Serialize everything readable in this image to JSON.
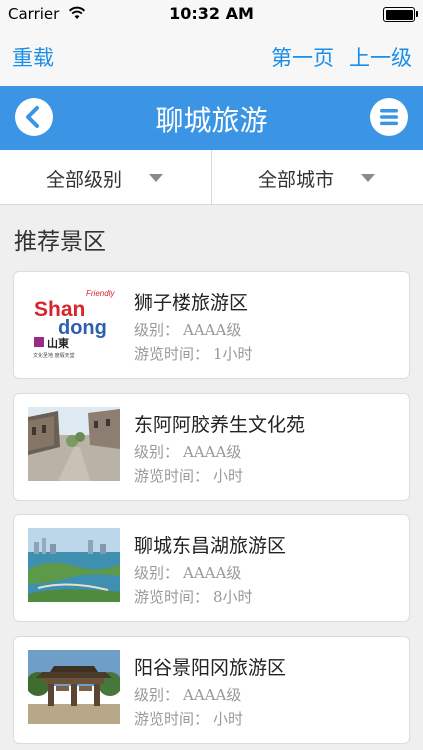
{
  "status_bar": {
    "carrier": "Carrier",
    "time": "10:32 AM",
    "wifi_icon": "wifi-icon",
    "battery_icon": "battery-icon"
  },
  "browser_nav": {
    "reload": "重载",
    "first_page": "第一页",
    "up_level": "上一级"
  },
  "header": {
    "title": "聊城旅游",
    "back_icon": "chevron-left-icon",
    "menu_icon": "menu-icon",
    "accent_color": "#3b95e4"
  },
  "filters": {
    "level": "全部级别",
    "city": "全部城市"
  },
  "section": {
    "title": "推荐景区"
  },
  "labels": {
    "level_label": "级别：",
    "time_label": "游览时间："
  },
  "spots": [
    {
      "name": "狮子楼旅游区",
      "level": "AAAA级",
      "duration": "1小时"
    },
    {
      "name": "东阿阿胶养生文化苑",
      "level": "AAAA级",
      "duration": "小时"
    },
    {
      "name": "聊城东昌湖旅游区",
      "level": "AAAA级",
      "duration": "8小时"
    },
    {
      "name": "阳谷景阳冈旅游区",
      "level": "AAAA级",
      "duration": "小时"
    }
  ],
  "logo_text": {
    "line1": "Shan",
    "line2": "dong",
    "friendly": "Friendly",
    "chinese": "山東",
    "slogan": "文化圣地  度假天堂"
  }
}
